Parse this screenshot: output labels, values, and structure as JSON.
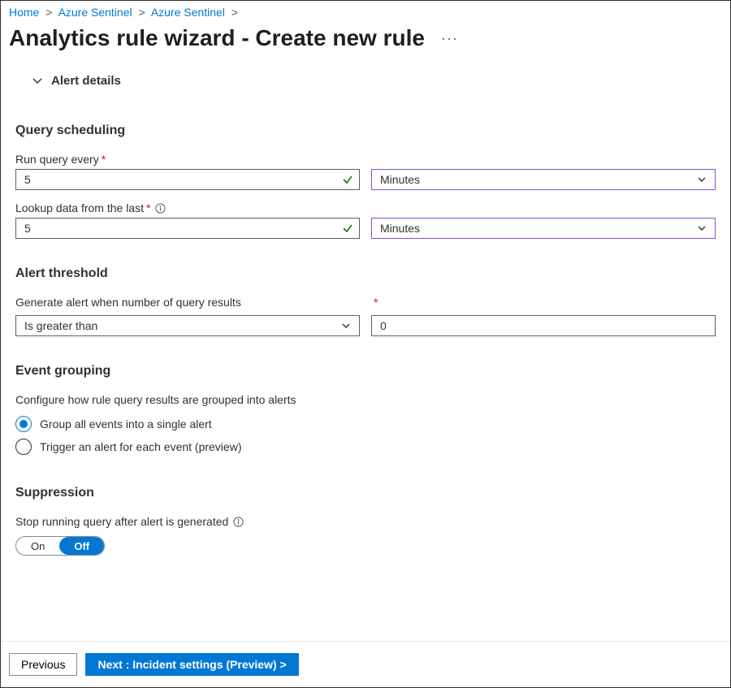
{
  "breadcrumb": {
    "items": [
      {
        "label": "Home"
      },
      {
        "label": "Azure Sentinel"
      },
      {
        "label": "Azure Sentinel"
      }
    ]
  },
  "page": {
    "title": "Analytics rule wizard - Create new rule"
  },
  "alertDetails": {
    "header": "Alert details"
  },
  "queryScheduling": {
    "title": "Query scheduling",
    "runEvery": {
      "label": "Run query every",
      "value": "5",
      "unit": "Minutes"
    },
    "lookup": {
      "label": "Lookup data from the last",
      "value": "5",
      "unit": "Minutes"
    }
  },
  "alertThreshold": {
    "title": "Alert threshold",
    "label": "Generate alert when number of query results",
    "operator": "Is greater than",
    "value": "0"
  },
  "eventGrouping": {
    "title": "Event grouping",
    "desc": "Configure how rule query results are grouped into alerts",
    "options": [
      {
        "label": "Group all events into a single alert",
        "selected": true
      },
      {
        "label": "Trigger an alert for each event (preview)",
        "selected": false
      }
    ]
  },
  "suppression": {
    "title": "Suppression",
    "label": "Stop running query after alert is generated",
    "on": "On",
    "off": "Off"
  },
  "footer": {
    "previous": "Previous",
    "next": "Next : Incident settings (Preview) >"
  }
}
